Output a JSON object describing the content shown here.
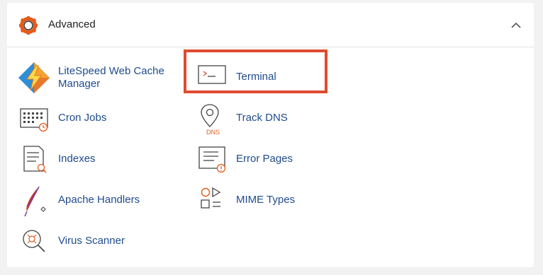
{
  "section": {
    "title": "Advanced",
    "icon": "gear-icon",
    "toggle_icon": "chevron-up-icon",
    "accent_color": "#e04a2f"
  },
  "items": [
    {
      "label": "LiteSpeed Web Cache Manager",
      "label_line1": "LiteSpeed Web Cache",
      "label_line2": "Manager",
      "icon": "litespeed-icon"
    },
    {
      "label": "Terminal",
      "icon": "terminal-icon",
      "highlighted": true
    },
    {
      "label": "Cron Jobs",
      "icon": "cron-jobs-icon"
    },
    {
      "label": "Track DNS",
      "icon": "track-dns-icon",
      "icon_text": "DNS"
    },
    {
      "label": "Indexes",
      "icon": "indexes-icon"
    },
    {
      "label": "Error Pages",
      "icon": "error-pages-icon"
    },
    {
      "label": "Apache Handlers",
      "icon": "apache-handlers-icon"
    },
    {
      "label": "MIME Types",
      "icon": "mime-types-icon"
    },
    {
      "label": "Virus Scanner",
      "icon": "virus-scanner-icon"
    }
  ]
}
